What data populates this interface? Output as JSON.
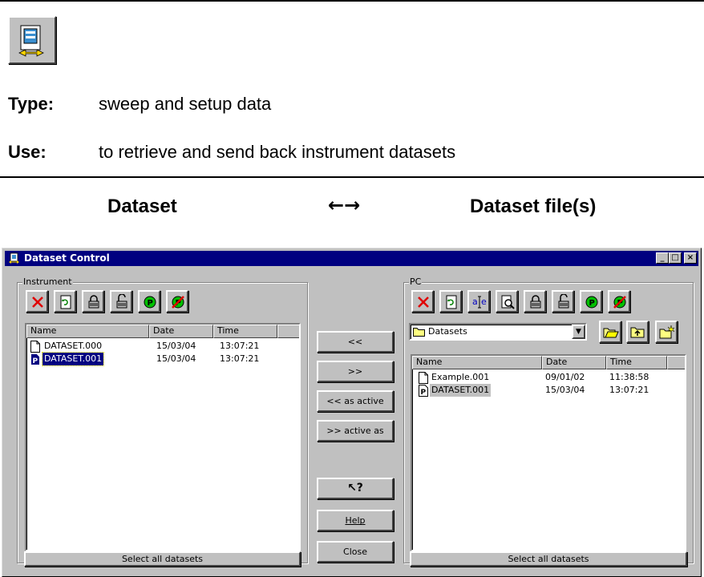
{
  "doc": {
    "type_label": "Type:",
    "type_value": "sweep and setup data",
    "use_label": "Use:",
    "use_value": "to retrieve and send back instrument datasets",
    "left_header": "Dataset",
    "arrows": "←→",
    "right_header": "Dataset file(s)"
  },
  "window": {
    "title": "Dataset Control",
    "min": "_",
    "max": "□",
    "close": "×"
  },
  "instrument": {
    "group_label": "Instrument",
    "toolbar_icons": [
      "delete-icon",
      "refresh-icon",
      "lock-icon",
      "unlock-icon",
      "protect-icon",
      "unprotect-icon"
    ],
    "columns": [
      "Name",
      "Date",
      "Time"
    ],
    "rows": [
      {
        "name": "DATASET.000",
        "date": "15/03/04",
        "time": "13:07:21",
        "icon": "file-icon",
        "selected": false
      },
      {
        "name": "DATASET.001",
        "date": "15/03/04",
        "time": "13:07:21",
        "icon": "active-file-icon",
        "selected": true
      }
    ],
    "select_all": "Select all datasets"
  },
  "middle": {
    "copy_left": "<<",
    "copy_right": ">>",
    "copy_left_active": "<< as active",
    "copy_right_active": ">> active as",
    "whats_this": "↖?",
    "help": "Help",
    "close": "Close"
  },
  "pc": {
    "group_label": "PC",
    "toolbar_icons": [
      "delete-icon",
      "refresh-icon",
      "rename-icon",
      "view-icon",
      "lock-icon",
      "unlock-icon",
      "protect-icon",
      "unprotect-icon"
    ],
    "folder": "Datasets",
    "folder_buttons": [
      "open-folder-icon",
      "up-folder-icon",
      "new-folder-icon"
    ],
    "columns": [
      "Name",
      "Date",
      "Time"
    ],
    "rows": [
      {
        "name": "Example.001",
        "date": "09/01/02",
        "time": "11:38:58",
        "icon": "file-icon",
        "selected": false
      },
      {
        "name": "DATASET.001",
        "date": "15/03/04",
        "time": "13:07:21",
        "icon": "protected-file-icon",
        "selected": true
      }
    ],
    "select_all": "Select all datasets"
  },
  "colors": {
    "titlebar": "#000080",
    "face": "#c0c0c0",
    "selection": "#000080"
  }
}
